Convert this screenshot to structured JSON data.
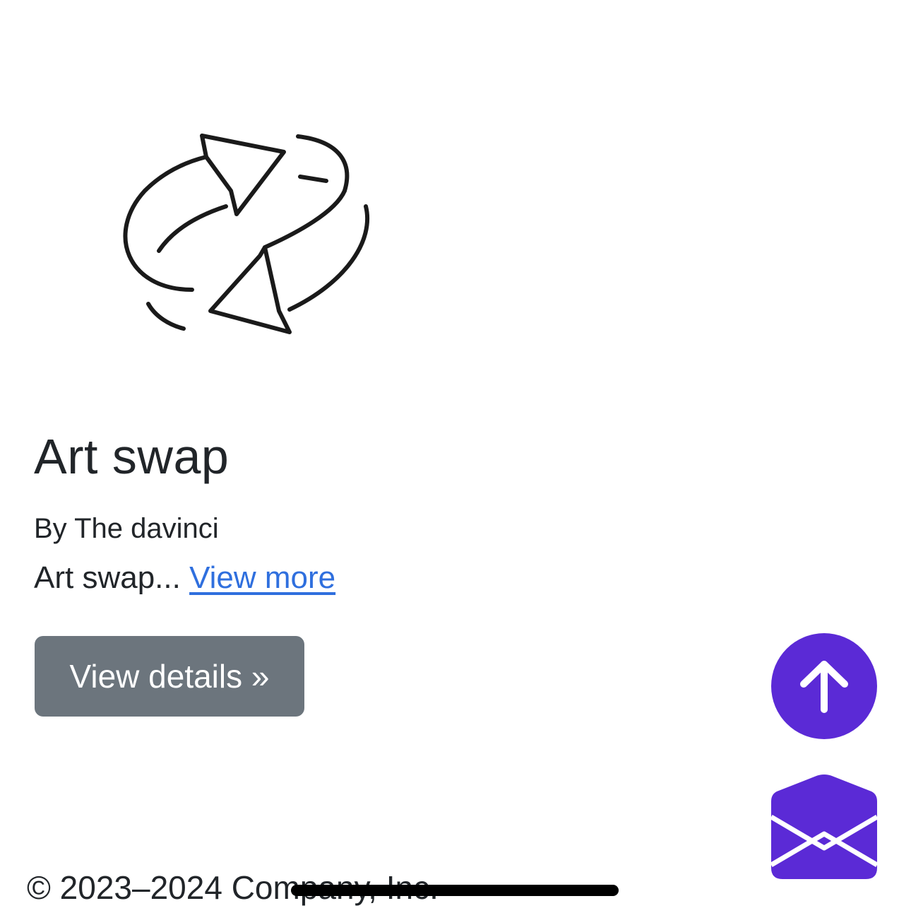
{
  "card": {
    "image_icon": "swap-arrows-icon",
    "title": "Art swap",
    "author": "By The davinci",
    "description": "Art swap...",
    "view_more_label": "View more",
    "details_button_label": "View details »"
  },
  "floating_actions": {
    "scroll_top_icon": "arrow-up-icon",
    "contact_icon": "envelope-open-icon",
    "accent_color": "#5b2ad6"
  },
  "footer": {
    "copyright": "© 2023–2024 Company, Inc."
  },
  "colors": {
    "link": "#2f6fde",
    "button_secondary": "#6c757d",
    "text": "#212529"
  }
}
